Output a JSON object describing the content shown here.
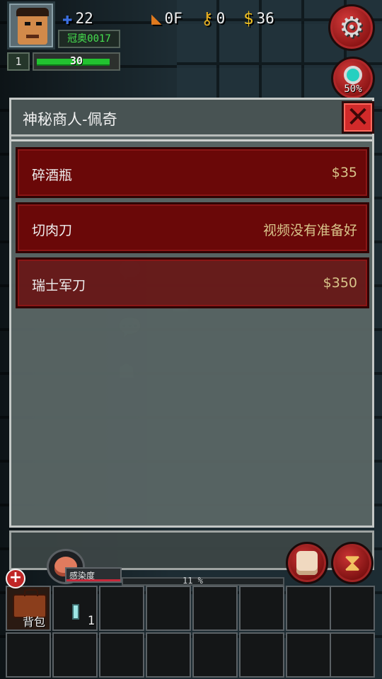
{
  "hud": {
    "player_id": "冠奥0017",
    "level": "1",
    "hp": "30",
    "hp_fraction": 0.92,
    "attack": "22",
    "floor": "0F",
    "keys": "0",
    "money": "36",
    "zoom": "50%",
    "icons": {
      "attack": "puzzle-icon",
      "floor": "stairs-icon",
      "keys": "key-icon",
      "money": "dollar-icon",
      "settings": "gear-icon",
      "search": "magnifier-icon"
    }
  },
  "merchant": {
    "title": "神秘商人-佩奇",
    "items": [
      {
        "name": "碎酒瓶",
        "price": "$35"
      },
      {
        "name": "切肉刀",
        "price": "视频没有准备好"
      },
      {
        "name": "瑞士军刀",
        "price": "$350"
      }
    ]
  },
  "bottom": {
    "infection_label": "感染度",
    "infection_pct": "11 %",
    "backpack_label": "背包",
    "slot_item_count": "1"
  },
  "colors": {
    "item_bg": "#6a0808",
    "price_gold": "#d8c48a",
    "hp_green": "#22c230",
    "button_red": "#d12a2a"
  }
}
